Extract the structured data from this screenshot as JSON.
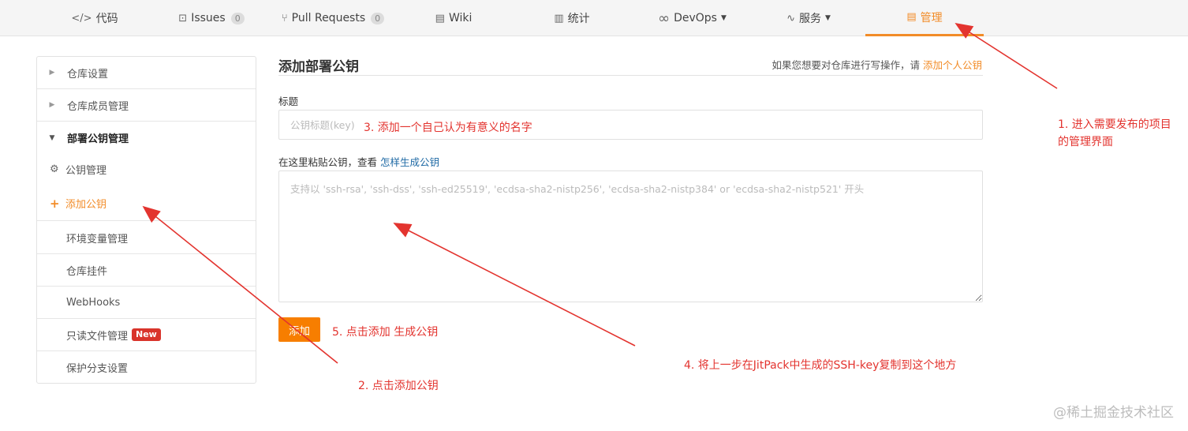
{
  "nav": {
    "tabs": [
      {
        "key": "code",
        "icon": "code-icon",
        "glyph": "</>",
        "label": "代码"
      },
      {
        "key": "issues",
        "icon": "issues-icon",
        "glyph": "⊡",
        "label": "Issues",
        "count": "0"
      },
      {
        "key": "pulls",
        "icon": "pull-request-icon",
        "glyph": "⑂",
        "label": "Pull Requests",
        "count": "0"
      },
      {
        "key": "wiki",
        "icon": "wiki-icon",
        "glyph": "▤",
        "label": "Wiki"
      },
      {
        "key": "stats",
        "icon": "bar-chart-icon",
        "glyph": "▥",
        "label": "统计"
      },
      {
        "key": "devops",
        "icon": "infinity-icon",
        "glyph": "∞",
        "label": "DevOps"
      },
      {
        "key": "services",
        "icon": "pulse-icon",
        "glyph": "∿",
        "label": "服务"
      },
      {
        "key": "manage",
        "icon": "manage-doc-icon",
        "glyph": "▤",
        "label": "管理"
      }
    ]
  },
  "sidebar": {
    "repo_settings": "仓库设置",
    "repo_members": "仓库成员管理",
    "deploy_keys_group": "部署公钥管理",
    "key_manage": "公钥管理",
    "add_key": "添加公钥",
    "env_vars": "环境变量管理",
    "repo_widgets": "仓库挂件",
    "webhooks": "WebHooks",
    "readonly_files": "只读文件管理",
    "new_badge": "New",
    "branch_protect": "保护分支设置"
  },
  "form": {
    "title": "添加部署公钥",
    "hint_prefix": "如果您想要对仓库进行写操作，请",
    "hint_link": "添加个人公钥",
    "title_label": "标题",
    "title_placeholder": "公钥标题(key)",
    "key_label_prefix": "在这里粘贴公钥，查看",
    "key_label_link": "怎样生成公钥",
    "key_placeholder": "支持以 'ssh-rsa', 'ssh-dss', 'ssh-ed25519', 'ecdsa-sha2-nistp256', 'ecdsa-sha2-nistp384' or 'ecdsa-sha2-nistp521' 开头",
    "submit_label": "添加"
  },
  "annotations": {
    "step1": "1. 进入需要发布的项目的管理界面",
    "step2": "2. 点击添加公钥",
    "step3": "3. 添加一个自己认为有意义的名字",
    "step4": "4.  将上一步在JitPack中生成的SSH-key复制到这个地方",
    "step5": "5. 点击添加 生成公钥"
  },
  "watermark": "@稀土掘金技术社区",
  "colors": {
    "accent": "#f28c28",
    "button": "#f77e00",
    "annotation": "#e3342f",
    "badge": "#d9342b",
    "link": "#1f6aa5"
  }
}
